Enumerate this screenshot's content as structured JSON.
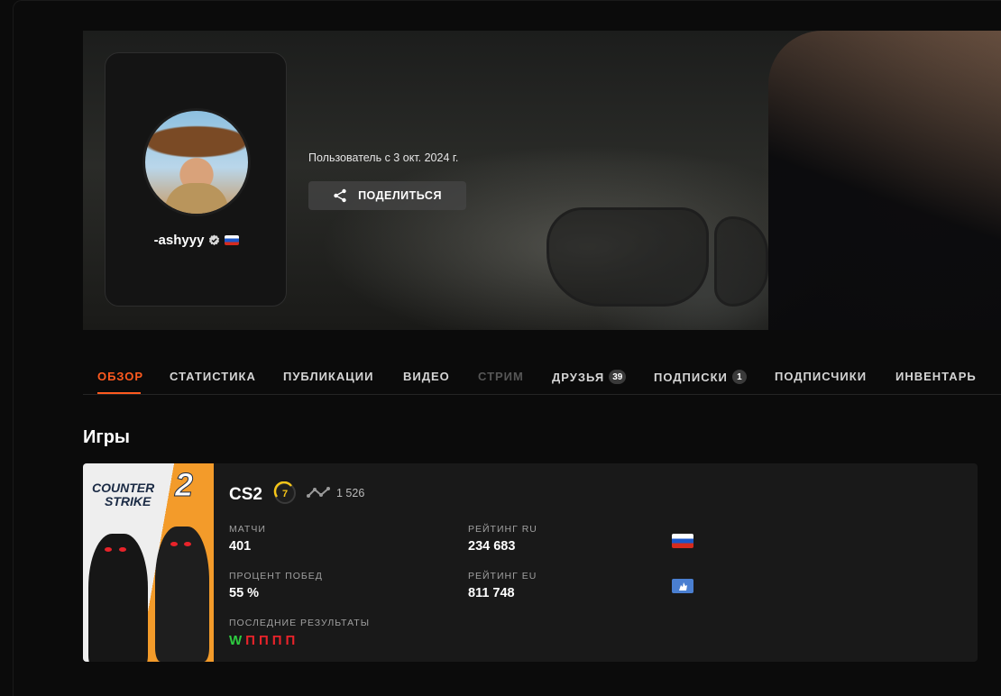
{
  "profile": {
    "username": "-ashyyy",
    "member_since": "Пользователь с 3 окт. 2024 г.",
    "share_label": "ПОДЕЛИТЬСЯ"
  },
  "tabs": [
    {
      "label": "ОБЗОР",
      "state": "active"
    },
    {
      "label": "СТАТИСТИКА",
      "state": "normal"
    },
    {
      "label": "ПУБЛИКАЦИИ",
      "state": "normal"
    },
    {
      "label": "ВИДЕО",
      "state": "normal"
    },
    {
      "label": "СТРИМ",
      "state": "disabled"
    },
    {
      "label": "ДРУЗЬЯ",
      "state": "normal",
      "badge": "39"
    },
    {
      "label": "ПОДПИСКИ",
      "state": "normal",
      "badge": "1"
    },
    {
      "label": "ПОДПИСЧИКИ",
      "state": "normal"
    },
    {
      "label": "ИНВЕНТАРЬ",
      "state": "normal"
    }
  ],
  "games": {
    "section_title": "Игры",
    "cs2": {
      "logo_line1": "COUNTER",
      "logo_line2": "STRIKE",
      "logo_number": "2",
      "name": "CS2",
      "level": "7",
      "elo": "1 526",
      "matches_label": "МАТЧИ",
      "matches": "401",
      "winrate_label": "ПРОЦЕНТ ПОБЕД",
      "winrate": "55 %",
      "recent_label": "ПОСЛЕДНИЕ РЕЗУЛЬТАТЫ",
      "recent_results": [
        "W",
        "П",
        "П",
        "П",
        "П"
      ],
      "rating_ru_label": "РЕЙТИНГ RU",
      "rating_ru": "234 683",
      "rating_eu_label": "РЕЙТИНГ EU",
      "rating_eu": "811 748"
    }
  },
  "colors": {
    "accent": "#ff5a1f",
    "win": "#2ecc40",
    "loss": "#e8232a",
    "level_ring": "#f5c518"
  }
}
